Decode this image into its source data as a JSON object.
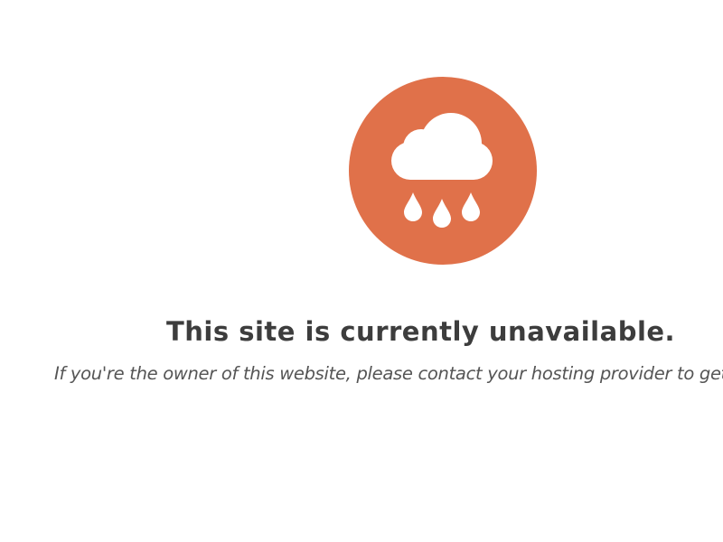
{
  "icon": {
    "name": "rain-cloud-icon",
    "circle_color": "#e0714a",
    "glyph_color": "#ffffff"
  },
  "message": {
    "title": "This site is currently unavailable.",
    "body": "If you're the owner of this website, please contact your hosting provider to get this resolved."
  },
  "colors": {
    "title": "#3d3d3d",
    "body": "#555555",
    "background": "#ffffff"
  }
}
